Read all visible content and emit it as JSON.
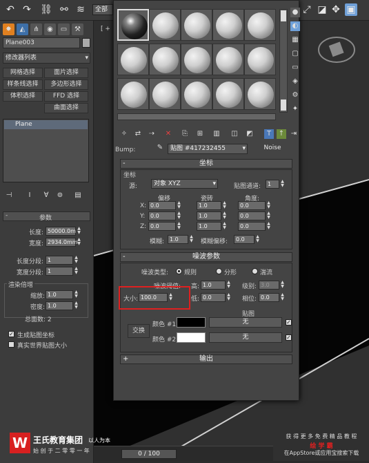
{
  "toolbar": {
    "selection_filter": "全部"
  },
  "cmdpanel": {
    "object_name": "Plane003",
    "modifier_list": "修改器列表",
    "modifier_buttons": [
      "网格选择",
      "面片选择",
      "样条线选择",
      "多边形选择",
      "体积选择",
      "FFD 选择",
      "曲面选择"
    ],
    "stack_item": "Plane",
    "params_title": "参数",
    "length_label": "长度:",
    "length_value": "50000.0m",
    "width_label": "宽度:",
    "width_value": "2934.0mm",
    "length_segs_label": "长度分段:",
    "length_segs_value": "1",
    "width_segs_label": "宽度分段:",
    "width_segs_value": "1",
    "render_mult_title": "渲染倍增",
    "scale_label": "缩放:",
    "scale_value": "1.0",
    "density_label": "密度:",
    "density_value": "1.0",
    "total_faces": "总面数: 2",
    "gen_mapping": "生成贴图坐标",
    "real_world": "真实世界贴图大小"
  },
  "mated": {
    "bump_label": "Bump:",
    "map_name": "贴图 #417232455",
    "map_type": "Noise",
    "coords_title": "坐标",
    "coords_group": "坐标",
    "source_label": "源:",
    "source_value": "对象 XYZ",
    "map_channel_label": "贴图通道:",
    "map_channel_value": "1",
    "offset_label": "偏移",
    "tiling_label": "瓷砖",
    "angle_label": "角度:",
    "axes": [
      "X:",
      "Y:",
      "Z:"
    ],
    "offset_values": [
      "0.0",
      "0.0",
      "0.0"
    ],
    "tiling_values": [
      "1.0",
      "1.0",
      "1.0"
    ],
    "angle_values": [
      "0.0",
      "0.0",
      "0.0"
    ],
    "blur_label": "模糊:",
    "blur_value": "1.0",
    "blur_offset_label": "模糊偏移:",
    "blur_offset_value": "0.0",
    "noise_title": "噪波参数",
    "noise_type_label": "噪波类型:",
    "noise_type_regular": "规则",
    "noise_type_fractal": "分形",
    "noise_type_turbulence": "湍流",
    "noise_threshold_label": "噪波阈值:",
    "high_label": "高:",
    "high_value": "1.0",
    "levels_label": "级别:",
    "levels_value": "3.0",
    "size_label": "大小:",
    "size_value": "100.0",
    "low_label": "低:",
    "low_value": "0.0",
    "phase_label": "相位:",
    "phase_value": "0.0",
    "maps_label": "贴图",
    "swap_label": "交换",
    "color1_label": "颜色 #1",
    "color2_label": "颜色 #2",
    "color1_map": "无",
    "color2_map": "无",
    "color1_hex": "#000000",
    "color2_hex": "#ffffff",
    "output_title": "输出"
  },
  "timeline": {
    "frame_counter": "0 / 100"
  },
  "watermark": {
    "brand": "王氏教育集团",
    "slogan_top": "以人为本",
    "slogan_bottom": "始 创 于 二 零 零 一 年",
    "promo_line1": "获 得 更 多 免 费 精 品 教 程",
    "promo_line2": "绘 学 霸",
    "promo_line3": "在AppStore或应用宝搜索下载"
  },
  "colors": {
    "accent_highlight": "#e02020",
    "orange_icon": "#e08020"
  }
}
